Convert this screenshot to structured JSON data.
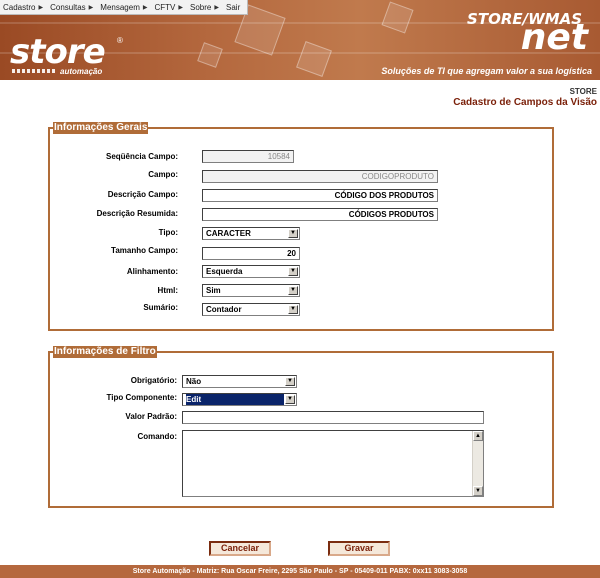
{
  "menu": [
    {
      "label": "Cadastro"
    },
    {
      "label": "Consultas"
    },
    {
      "label": "Mensagem"
    },
    {
      "label": "CFTV"
    },
    {
      "label": "Sobre"
    },
    {
      "label": "Sair"
    }
  ],
  "header": {
    "logo_text": "store",
    "logo_reg": "®",
    "logo_sub": "automação",
    "brand_top": "STORE/WMAS",
    "brand_net": "net",
    "tagline": "Soluções de TI que agregam valor a sua logística",
    "colors": {
      "banner": "#b06c38",
      "title": "#7a1f08"
    }
  },
  "breadcrumb": "STORE",
  "page_title": "Cadastro de Campos da Visão",
  "general": {
    "legend": "Informações Gerais",
    "fields": {
      "sequencia": {
        "label": "Seqüência Campo:",
        "value": "10584"
      },
      "campo": {
        "label": "Campo:",
        "value": "CODIGOPRODUTO"
      },
      "descricao": {
        "label": "Descrição Campo:",
        "value": "CÓDIGO DOS PRODUTOS"
      },
      "descricao_resumida": {
        "label": "Descrição Resumida:",
        "value": "CÓDIGOS PRODUTOS"
      },
      "tipo": {
        "label": "Tipo:",
        "value": "CARACTER"
      },
      "tamanho": {
        "label": "Tamanho Campo:",
        "value": "20"
      },
      "alinhamento": {
        "label": "Alinhamento:",
        "value": "Esquerda"
      },
      "html": {
        "label": "Html:",
        "value": "Sim"
      },
      "sumario": {
        "label": "Sumário:",
        "value": "Contador"
      }
    }
  },
  "filter": {
    "legend": "Informações de Filtro",
    "fields": {
      "obrigatorio": {
        "label": "Obrigatório:",
        "value": "Não"
      },
      "tipo_componente": {
        "label": "Tipo Componente:",
        "value": "Edit"
      },
      "valor_padrao": {
        "label": "Valor Padrão:",
        "value": ""
      },
      "comando": {
        "label": "Comando:",
        "value": ""
      }
    }
  },
  "actions": {
    "cancel": "Cancelar",
    "save": "Gravar"
  },
  "footer": "Store Automação - Matriz: Rua Oscar Freire, 2295 São Paulo - SP - 05409-011 PABX: 0xx11 3083-3058"
}
